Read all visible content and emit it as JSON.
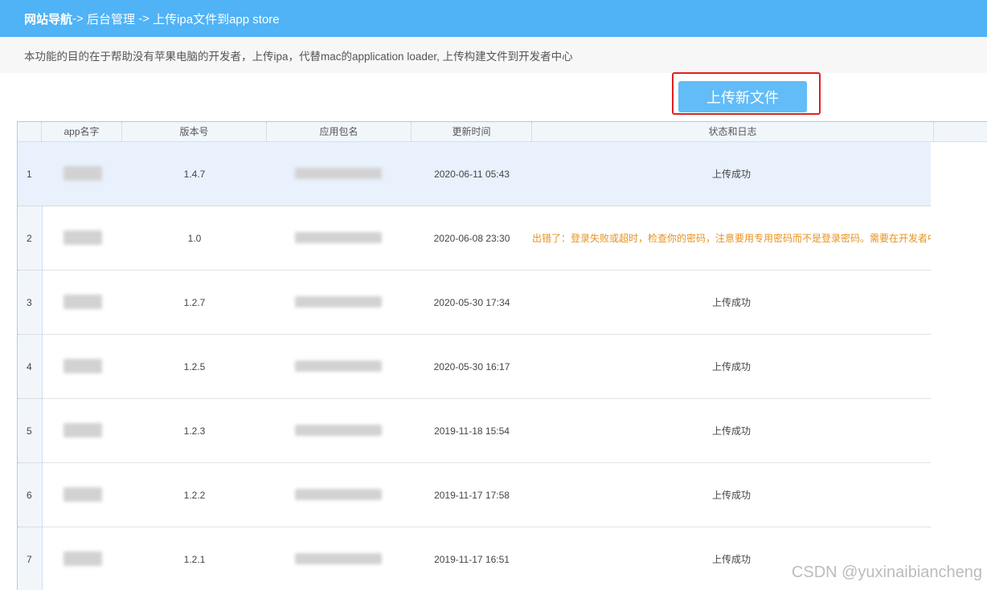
{
  "breadcrumb": {
    "home": "网站导航",
    "sep1": "-> ",
    "admin": "后台管理",
    "sep2": " -> ",
    "current": "上传ipa文件到app store"
  },
  "description": "本功能的目的在于帮助没有苹果电脑的开发者，上传ipa，代替mac的application loader, 上传构建文件到开发者中心",
  "upload_button_label": "上传新文件",
  "table": {
    "columns": [
      "app名字",
      "版本号",
      "应用包名",
      "更新时间",
      "状态和日志"
    ],
    "rows": [
      {
        "index": "1",
        "version": "1.4.7",
        "time": "2020-06-11 05:43",
        "status": "上传成功",
        "error": false
      },
      {
        "index": "2",
        "version": "1.0",
        "time": "2020-06-08 23:30",
        "status": "出错了：登录失败或超时，检查你的密码，注意要用专用密码而不是登录密码。需要在开发者中",
        "error": true
      },
      {
        "index": "3",
        "version": "1.2.7",
        "time": "2020-05-30 17:34",
        "status": "上传成功",
        "error": false
      },
      {
        "index": "4",
        "version": "1.2.5",
        "time": "2020-05-30 16:17",
        "status": "上传成功",
        "error": false
      },
      {
        "index": "5",
        "version": "1.2.3",
        "time": "2019-11-18 15:54",
        "status": "上传成功",
        "error": false
      },
      {
        "index": "6",
        "version": "1.2.2",
        "time": "2019-11-17 17:58",
        "status": "上传成功",
        "error": false
      },
      {
        "index": "7",
        "version": "1.2.1",
        "time": "2019-11-17 16:51",
        "status": "上传成功",
        "error": false
      }
    ]
  },
  "watermark": "CSDN @yuxinaibiancheng"
}
